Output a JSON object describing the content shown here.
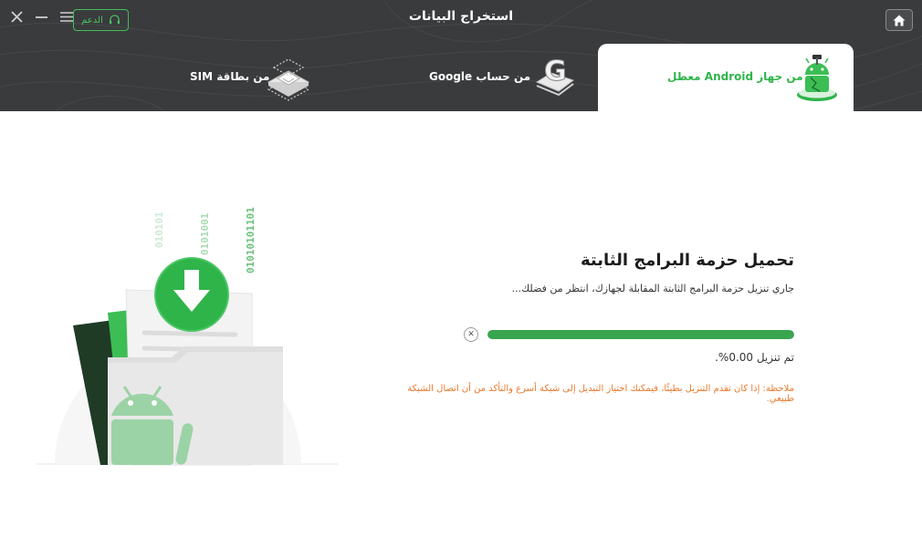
{
  "window": {
    "title": "استخراج البيانات",
    "support_label": "الدعم"
  },
  "tabs": [
    {
      "label": "من جهاز Android معطل",
      "active": true,
      "icon": "android-repair-icon"
    },
    {
      "label": "من حساب Google",
      "active": false,
      "icon": "google-account-icon"
    },
    {
      "label": "من بطاقة SIM",
      "active": false,
      "icon": "sim-card-icon"
    }
  ],
  "main": {
    "heading": "تحميل حزمة البرامج الثابتة",
    "subtext": "جاري تنزيل حزمة البرامج الثابتة المقابلة لجهازك، انتظر من فضلك...",
    "progress": {
      "percent": 0.0,
      "label": "تم تنزيل 0.00%."
    },
    "note": "ملاحظة: إذا كان تقدم التنزيل بطيئًا، فيمكنك اختيار التبديل إلى شبكة أسرع والتأكد من أن اتصال الشبكة طبيعي.",
    "illustration": {
      "binary_1": "010101",
      "binary_2": "0101001",
      "binary_3": "01010101101"
    }
  },
  "colors": {
    "header_bg": "#3a3b3d",
    "accent_green": "#3aa54f",
    "note_orange": "#e8782a",
    "progress_track": "#e2e2e2"
  }
}
